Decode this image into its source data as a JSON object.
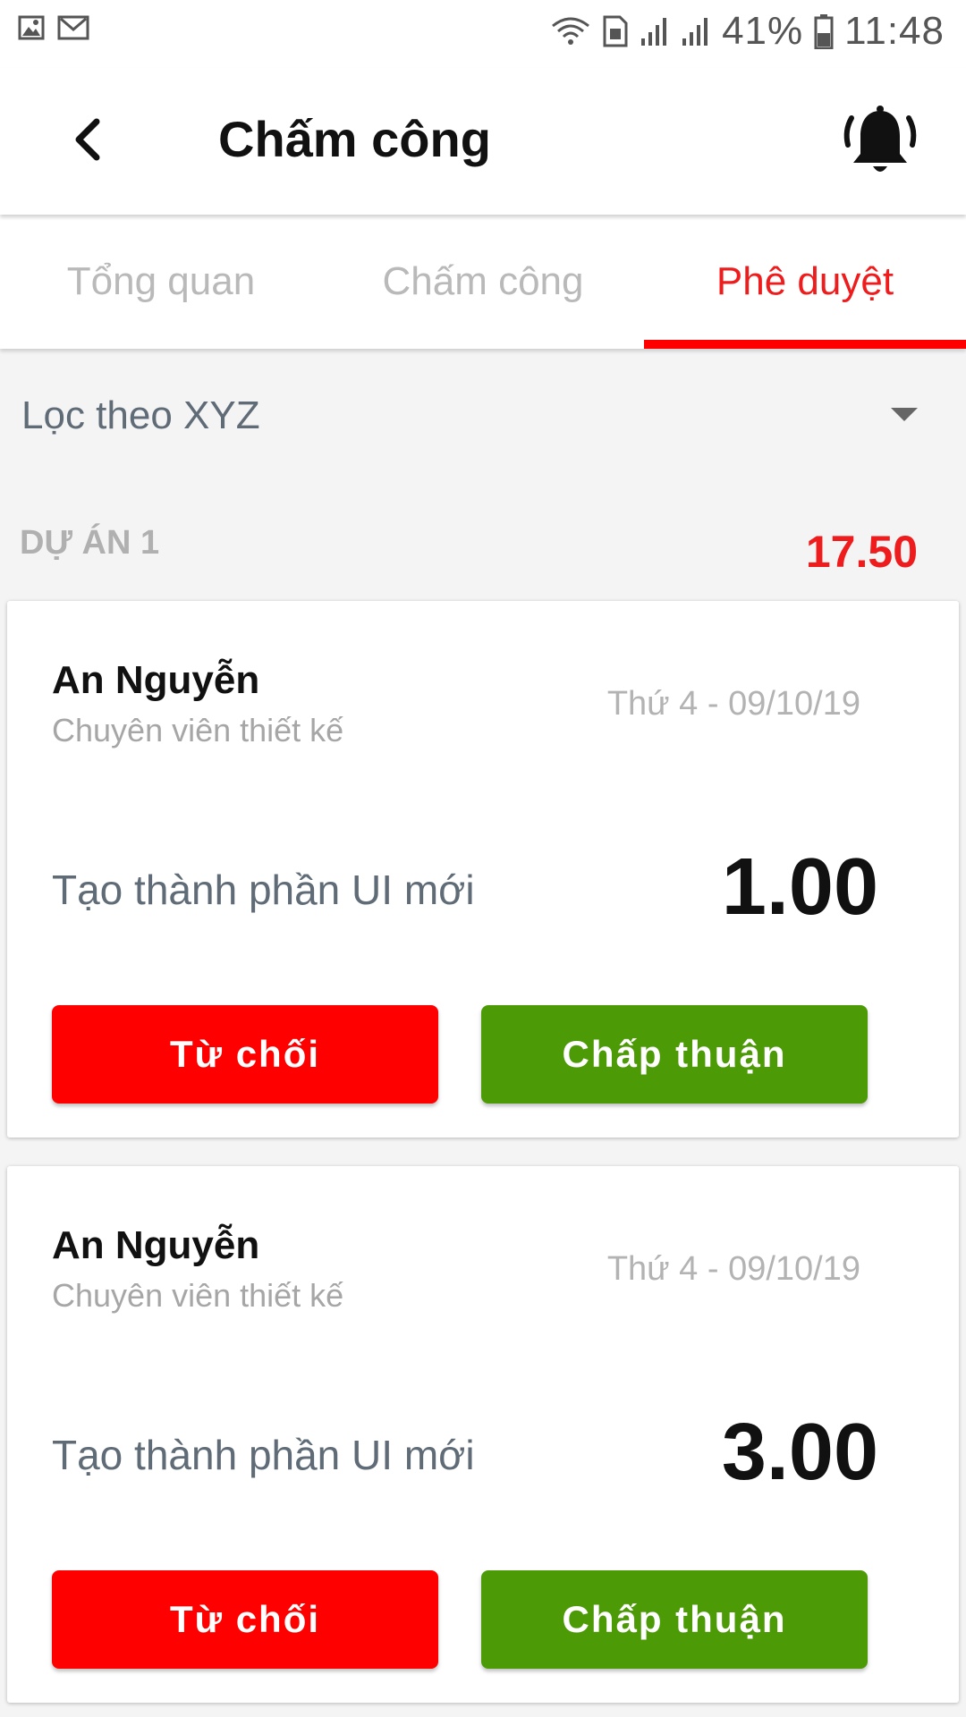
{
  "status_bar": {
    "battery_percent": "41%",
    "time": "11:48",
    "icons": [
      "image-icon",
      "mail-icon",
      "wifi-icon",
      "sim-icon",
      "signal-icon",
      "signal-icon",
      "battery-icon"
    ]
  },
  "app_bar": {
    "title": "Chấm công",
    "back_icon": "chevron-left-icon",
    "notification_icon": "bell-ringing-icon"
  },
  "tabs": [
    {
      "label": "Tổng quan",
      "active": false
    },
    {
      "label": "Chấm công",
      "active": false
    },
    {
      "label": "Phê duyệt",
      "active": true
    }
  ],
  "filter": {
    "label": "Lọc theo XYZ",
    "icon": "caret-down-icon"
  },
  "section": {
    "title": "DỰ ÁN 1",
    "total": "17.50"
  },
  "cards": [
    {
      "name": "An Nguyễn",
      "role": "Chuyên viên thiết kế",
      "date": "Thứ 4 - 09/10/19",
      "task": "Tạo thành phần UI mới",
      "hours": "1.00",
      "reject_label": "Từ chối",
      "approve_label": "Chấp thuận"
    },
    {
      "name": "An Nguyễn",
      "role": "Chuyên viên thiết kế",
      "date": "Thứ 4 - 09/10/19",
      "task": "Tạo thành phần UI mới",
      "hours": "3.00",
      "reject_label": "Từ chối",
      "approve_label": "Chấp thuận"
    }
  ],
  "colors": {
    "accent_red": "#ff0000",
    "approve_green": "#4c9a06",
    "tab_inactive": "#b9b9b9"
  }
}
